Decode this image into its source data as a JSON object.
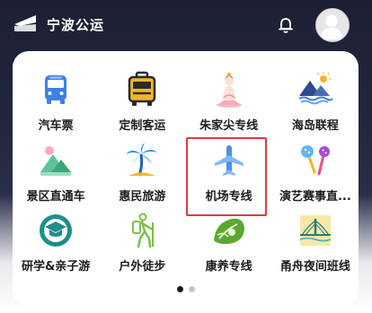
{
  "header": {
    "logo_icon": "flag-logo-icon",
    "title": "宁波公运",
    "bell_icon": "bell-icon",
    "avatar_icon": "user-avatar-icon"
  },
  "grid": {
    "items": [
      {
        "label": "汽车票",
        "icon": "bus-icon"
      },
      {
        "label": "定制客运",
        "icon": "luggage-bus-icon"
      },
      {
        "label": "朱家尖专线",
        "icon": "guanyin-icon"
      },
      {
        "label": "海岛联程",
        "icon": "island-mountain-icon"
      },
      {
        "label": "景区直通车",
        "icon": "scenic-mountain-icon"
      },
      {
        "label": "惠民旅游",
        "icon": "palm-tree-icon"
      },
      {
        "label": "机场专线",
        "icon": "airplane-icon"
      },
      {
        "label": "演艺赛事直...",
        "icon": "microphone-icon"
      },
      {
        "label": "研学&亲子游",
        "icon": "graduation-cap-icon"
      },
      {
        "label": "户外徒步",
        "icon": "hiker-icon"
      },
      {
        "label": "康养专线",
        "icon": "wellness-leaf-icon"
      },
      {
        "label": "甬舟夜间班线",
        "icon": "bridge-icon"
      }
    ],
    "highlighted": "机场专线",
    "highlight_color": "#e0393e"
  },
  "pagination": {
    "total": 2,
    "current": 1
  }
}
